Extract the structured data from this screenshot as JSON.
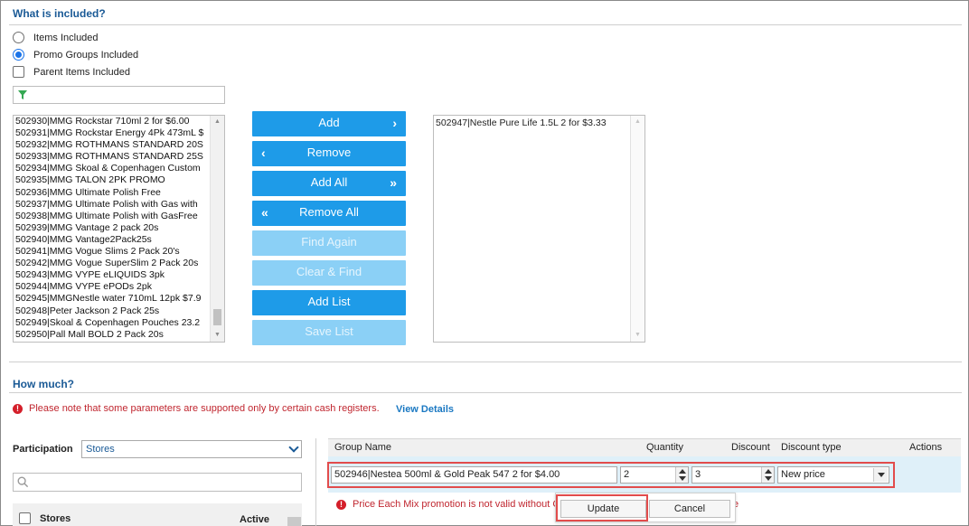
{
  "what_included": {
    "title": "What is included?",
    "options": [
      {
        "label": "Items Included",
        "checked": false
      },
      {
        "label": "Promo Groups Included",
        "checked": true
      }
    ],
    "parent_items_label": "Parent Items Included",
    "filter_placeholder": ""
  },
  "available_list": {
    "items": [
      "502930|MMG Rockstar 710ml 2 for $6.00",
      "502931|MMG Rockstar Energy 4Pk 473mL $",
      "502932|MMG ROTHMANS STANDARD 20S",
      "502933|MMG ROTHMANS STANDARD 25S",
      "502934|MMG Skoal & Copenhagen Custom",
      "502935|MMG TALON 2PK PROMO",
      "502936|MMG Ultimate Polish Free",
      "502937|MMG Ultimate Polish with Gas with",
      "502938|MMG Ultimate Polish with GasFree",
      "502939|MMG Vantage 2 pack 20s",
      "502940|MMG Vantage2Pack25s",
      "502941|MMG Vogue Slims 2 Pack 20's",
      "502942|MMG Vogue SuperSlim 2 Pack 20s",
      "502943|MMG VYPE eLIQUIDS 3pk",
      "502944|MMG VYPE ePODs 2pk",
      "502945|MMGNestle water 710mL 12pk $7.9",
      "502948|Peter Jackson 2 Pack 25s",
      "502949|Skoal & Copenhagen Pouches 23.2",
      "502950|Pall Mall BOLD 2 Pack 20s"
    ]
  },
  "buttons": {
    "add": "Add",
    "remove": "Remove",
    "add_all": "Add All",
    "remove_all": "Remove All",
    "find_again": "Find Again",
    "clear_find": "Clear & Find",
    "add_list": "Add List",
    "save_list": "Save List"
  },
  "selected_list": {
    "items": [
      "502947|Nestle Pure Life 1.5L 2 for $3.33"
    ]
  },
  "how_much": {
    "title": "How much?",
    "note": "Please note that some parameters are supported only by certain cash registers.",
    "view_details": "View Details",
    "participation_label": "Participation",
    "participation_value": "Stores",
    "search_placeholder": "",
    "stores_header": {
      "stores": "Stores",
      "active": "Active"
    }
  },
  "grid": {
    "headers": {
      "group_name": "Group Name",
      "quantity": "Quantity",
      "discount": "Discount",
      "discount_type": "Discount type",
      "actions": "Actions"
    },
    "row": {
      "group_name": "502946|Nestea 500ml & Gold Peak 547 2 for $4.00",
      "quantity": "2",
      "discount": "3",
      "discount_type": "New price"
    },
    "error_text": "Price Each Mix promotion is not valid without C",
    "error_tail": "e"
  },
  "popup": {
    "update": "Update",
    "cancel": "Cancel"
  },
  "colors": {
    "accent": "#1e9be8",
    "accent_disabled": "#8bd0f6",
    "title": "#1a5a96",
    "error": "#c0262f",
    "highlight": "#e24c4c",
    "row_selected": "#dff0f9"
  }
}
